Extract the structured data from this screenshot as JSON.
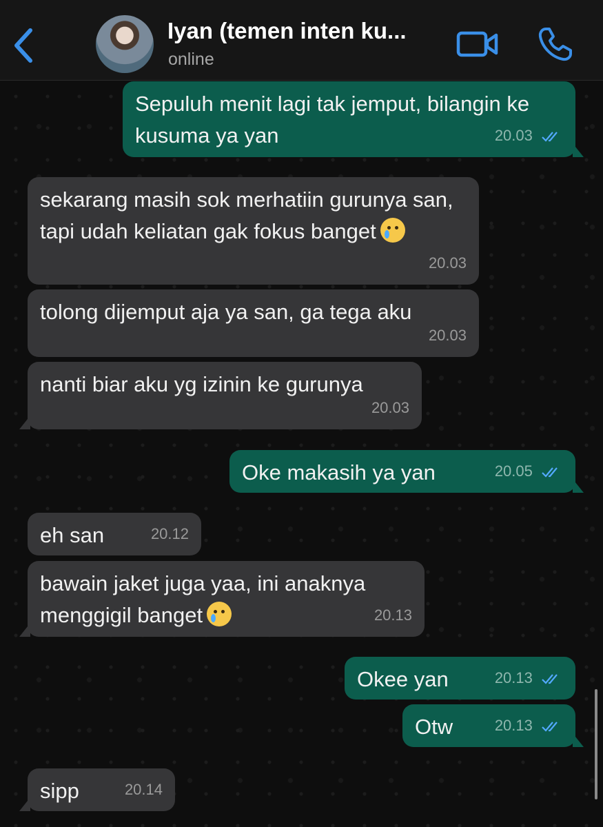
{
  "header": {
    "title": "Iyan (temen inten ku...",
    "status": "online",
    "icons": [
      "chevron-left-icon",
      "video-camera-icon",
      "phone-icon"
    ],
    "accent_color": "#3a8fe8"
  },
  "messages": [
    {
      "dir": "out",
      "text": "Sepuluh menit lagi tak jemput, bilangin ke kusuma ya yan",
      "time": "20.03",
      "read": true
    },
    {
      "dir": "in",
      "text": "sekarang masih sok merhatiin gurunya san, tapi udah keliatan gak fokus banget",
      "emoji": "crying-face-emoji",
      "time": "20.03"
    },
    {
      "dir": "in",
      "text": "tolong dijemput aja ya san, ga tega aku",
      "time": "20.03"
    },
    {
      "dir": "in",
      "text": "nanti biar aku yg izinin ke gurunya",
      "time": "20.03"
    },
    {
      "dir": "out",
      "text": "Oke makasih ya yan",
      "time": "20.05",
      "read": true
    },
    {
      "dir": "in",
      "text": "eh san",
      "time": "20.12"
    },
    {
      "dir": "in",
      "text": "bawain jaket juga yaa, ini anaknya menggigil banget",
      "emoji": "loudly-crying-face-emoji",
      "time": "20.13"
    },
    {
      "dir": "out",
      "text": "Okee yan",
      "time": "20.13",
      "read": true
    },
    {
      "dir": "out",
      "text": "Otw",
      "time": "20.13",
      "read": true
    },
    {
      "dir": "in",
      "text": "sipp",
      "time": "20.14"
    }
  ],
  "colors": {
    "incoming_bubble": "#363638",
    "outgoing_bubble": "#0c5d4d",
    "read_ticks": "#53a9ff"
  }
}
